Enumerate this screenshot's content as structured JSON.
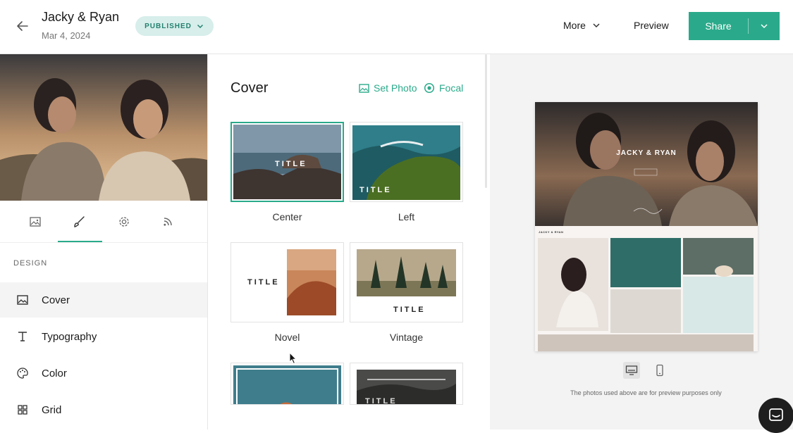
{
  "header": {
    "title": "Jacky & Ryan",
    "date": "Mar 4, 2024",
    "status_badge": "PUBLISHED",
    "more_label": "More",
    "preview_label": "Preview",
    "share_label": "Share"
  },
  "sidebar": {
    "section_title": "DESIGN",
    "tabs": [
      "image-icon",
      "brush-icon",
      "gear-icon",
      "rss-icon"
    ],
    "active_tab": 1,
    "items": [
      {
        "label": "Cover",
        "icon": "image-icon",
        "active": true
      },
      {
        "label": "Typography",
        "icon": "text-icon",
        "active": false
      },
      {
        "label": "Color",
        "icon": "palette-icon",
        "active": false
      },
      {
        "label": "Grid",
        "icon": "grid-icon",
        "active": false
      }
    ]
  },
  "panel": {
    "title": "Cover",
    "set_photo_label": "Set Photo",
    "focal_label": "Focal",
    "cover_styles": [
      {
        "label": "Center",
        "title_text": "TITLE",
        "selected": true
      },
      {
        "label": "Left",
        "title_text": "TITLE",
        "selected": false
      },
      {
        "label": "Novel",
        "title_text": "TITLE",
        "selected": false
      },
      {
        "label": "Vintage",
        "title_text": "TITLE",
        "selected": false
      },
      {
        "label": "",
        "title_text": "",
        "selected": false
      },
      {
        "label": "",
        "title_text": "TITLE",
        "selected": false
      }
    ]
  },
  "preview": {
    "cover_title": "JACKY & RYAN",
    "nav_title": "JACKY & RYAN",
    "note": "The photos used above are for preview purposes only",
    "devices": [
      "desktop-icon",
      "mobile-icon"
    ],
    "active_device": 0
  },
  "colors": {
    "accent": "#2aaa8a",
    "badge_bg": "#d7eeea",
    "badge_text": "#23806f",
    "preview_bg": "#f3f3f3"
  }
}
